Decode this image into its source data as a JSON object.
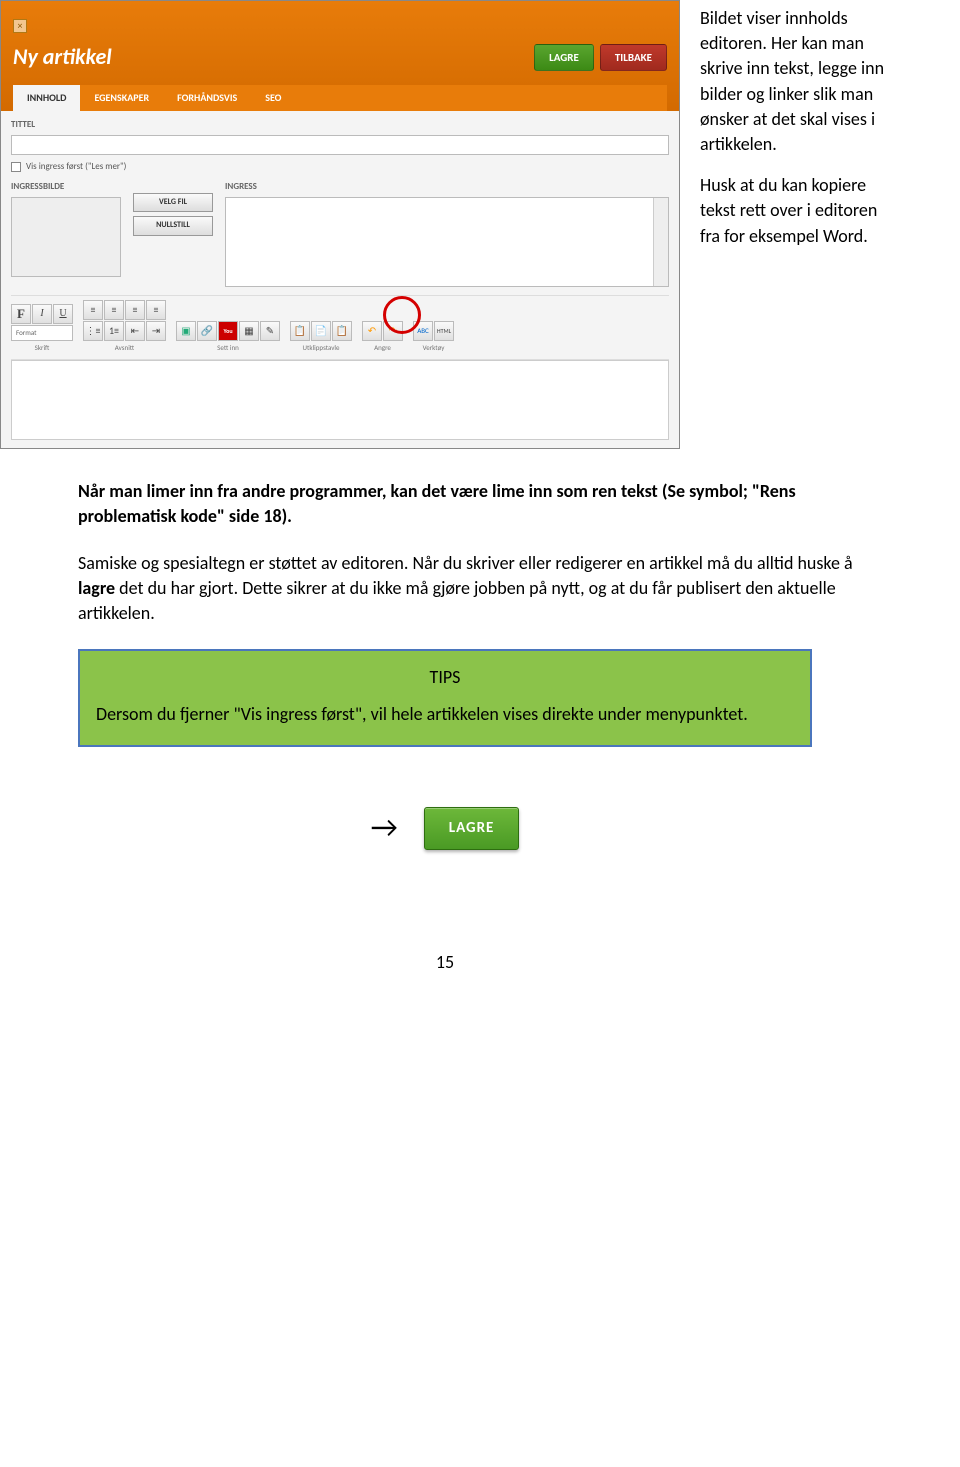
{
  "screenshot": {
    "title": "Ny artikkel",
    "buttons": {
      "save": "LAGRE",
      "back": "TILBAKE"
    },
    "tabs": [
      "INNHOLD",
      "EGENSKAPER",
      "FORHÅNDSVIS",
      "SEO"
    ],
    "fields": {
      "tittel_label": "TITTEL",
      "vis_ingress_label": "Vis ingress først (\"Les mer\")",
      "ingressbilde_label": "INGRESSBILDE",
      "ingress_label": "INGRESS",
      "velg_fil": "VELG FIL",
      "nullstill": "NULLSTILL"
    },
    "toolbar": {
      "format": "Format",
      "groups": [
        "Skrift",
        "Avsnitt",
        "Sett inn",
        "Utklippstavle",
        "Angre",
        "Verktøy"
      ],
      "abc": "ABC",
      "html": "HTML"
    }
  },
  "side_text": {
    "p1": "Bildet viser innholds editoren. Her kan man skrive inn tekst, legge inn bilder og linker slik man ønsker at det skal vises i artikkelen.",
    "p2": "Husk at du kan kopiere tekst rett over i editoren fra for eksempel Word."
  },
  "body": {
    "p1a": "Når man limer inn fra andre programmer, kan det være lime inn som ren tekst (Se symbol; \"Rens problematisk kode\" side 18).",
    "p2a": "Samiske og spesialtegn er støttet av editoren.  Når du skriver eller redigerer en artikkel må du alltid huske å ",
    "p2bold": "lagre",
    "p2b": " det du har gjort. Dette sikrer at du ikke må gjøre jobben på nytt, og at du får publisert den aktuelle artikkelen."
  },
  "tips": {
    "title": "TIPS",
    "body": "Dersom du fjerner \"Vis ingress først\", vil hele artikkelen vises direkte under menypunktet."
  },
  "lagre_btn": "LAGRE",
  "page_number": "15"
}
